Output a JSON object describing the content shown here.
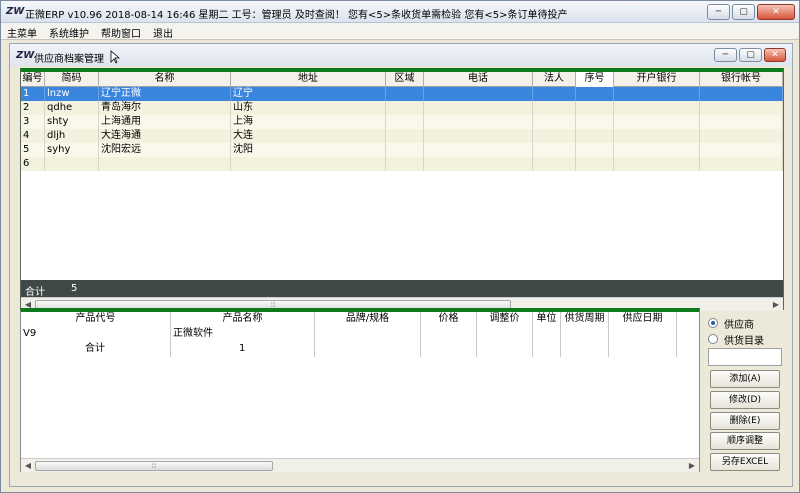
{
  "window": {
    "title": "正微ERP v10.96   2018-08-14 16:46 星期二   工号：管理员   及时查阅！ 您有<5>条收货单需检验 您有<5>条订单待投产",
    "logo": "ZW"
  },
  "menu": [
    "主菜单",
    "系统维护",
    "帮助窗口",
    "退出"
  ],
  "child_window": {
    "title": "供应商档案管理"
  },
  "top_grid": {
    "columns": [
      "编号",
      "简码",
      "名称",
      "地址",
      "区域",
      "电话",
      "法人",
      "序号",
      "开户银行",
      "银行帐号"
    ],
    "rows": [
      {
        "num": "1",
        "code": "lnzw",
        "name": "辽宁正微",
        "addr": "辽宁"
      },
      {
        "num": "2",
        "code": "qdhe",
        "name": "青岛海尔",
        "addr": "山东"
      },
      {
        "num": "3",
        "code": "shty",
        "name": "上海通用",
        "addr": "上海"
      },
      {
        "num": "4",
        "code": "dljh",
        "name": "大连海通",
        "addr": "大连"
      },
      {
        "num": "5",
        "code": "syhy",
        "name": "沈阳宏远",
        "addr": "沈阳"
      },
      {
        "num": "6",
        "code": "",
        "name": "",
        "addr": ""
      }
    ],
    "footer": {
      "label": "合计",
      "count": "5"
    }
  },
  "bottom_grid": {
    "columns": [
      "产品代号",
      "产品名称",
      "品牌/规格",
      "价格",
      "调整价",
      "单位",
      "供货周期",
      "供应日期"
    ],
    "rows": [
      {
        "code": "V9",
        "name": "正微软件",
        "qty": ""
      },
      {
        "code": "合计",
        "name": "",
        "qty": "1"
      }
    ]
  },
  "right_panel": {
    "radio_supplier": "供应商",
    "radio_catalog": "供货目录",
    "buttons": [
      "添加(A)",
      "修改(D)",
      "删除(E)",
      "顺序调整",
      "另存EXCEL"
    ]
  }
}
